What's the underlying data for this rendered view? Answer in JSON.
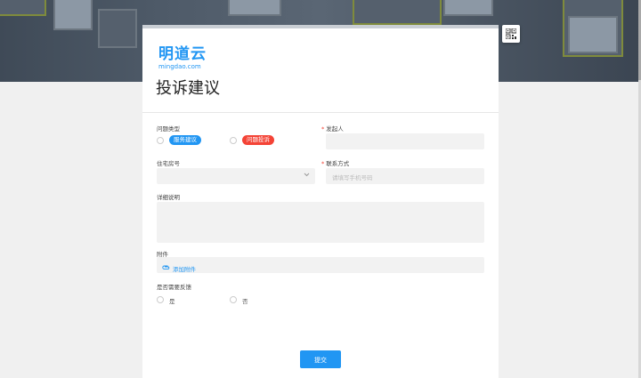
{
  "brand": {
    "name_cn": "明道云",
    "domain": "mingdao.com",
    "accent": "#2196f3"
  },
  "form": {
    "title": "投诉建议",
    "fields": {
      "issue_type": {
        "label": "问题类型",
        "options": [
          "服务建议",
          "问题投诉"
        ],
        "option_colors": [
          "#2196f3",
          "#f44336"
        ]
      },
      "initiator": {
        "label": "发起人",
        "required_mark": "*"
      },
      "residence": {
        "label": "住宅房号"
      },
      "contact": {
        "label": "联系方式",
        "required_mark": "*",
        "placeholder": "请填写手机号码"
      },
      "details": {
        "label": "详细说明"
      },
      "attachment": {
        "label": "附件",
        "add_label": "添加附件"
      },
      "feedback": {
        "label": "是否需要反馈",
        "options": [
          "是",
          "否"
        ]
      }
    },
    "submit_label": "提交"
  }
}
